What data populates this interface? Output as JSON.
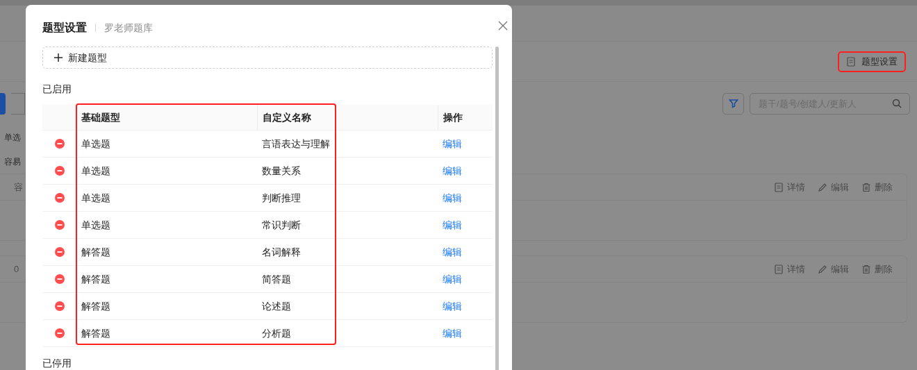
{
  "background": {
    "settings_button": {
      "label": "题型设置",
      "highlighted": true
    },
    "search": {
      "placeholder": "题干/题号/创建人/更新人"
    },
    "left_labels": [
      "单选",
      "容易"
    ],
    "cards": [
      {
        "fragment": "容",
        "actions": [
          "详情",
          "编辑",
          "删除"
        ]
      },
      {
        "fragment": "0",
        "actions": [
          "详情",
          "编辑",
          "删除"
        ]
      }
    ]
  },
  "dialog": {
    "title": "题型设置",
    "subtitle": "罗老师题库",
    "new_button": "新建题型",
    "enabled_section": {
      "heading": "已启用",
      "highlighted": true,
      "columns": [
        "基础题型",
        "自定义名称",
        "操作"
      ],
      "rows": [
        {
          "base": "单选题",
          "name": "言语表达与理解",
          "action": "编辑"
        },
        {
          "base": "单选题",
          "name": "数量关系",
          "action": "编辑"
        },
        {
          "base": "单选题",
          "name": "判断推理",
          "action": "编辑"
        },
        {
          "base": "单选题",
          "name": "常识判断",
          "action": "编辑"
        },
        {
          "base": "解答题",
          "name": "名词解释",
          "action": "编辑"
        },
        {
          "base": "解答题",
          "name": "简答题",
          "action": "编辑"
        },
        {
          "base": "解答题",
          "name": "论述题",
          "action": "编辑"
        },
        {
          "base": "解答题",
          "name": "分析题",
          "action": "编辑"
        }
      ]
    },
    "disabled_section": {
      "heading": "已停用"
    }
  }
}
